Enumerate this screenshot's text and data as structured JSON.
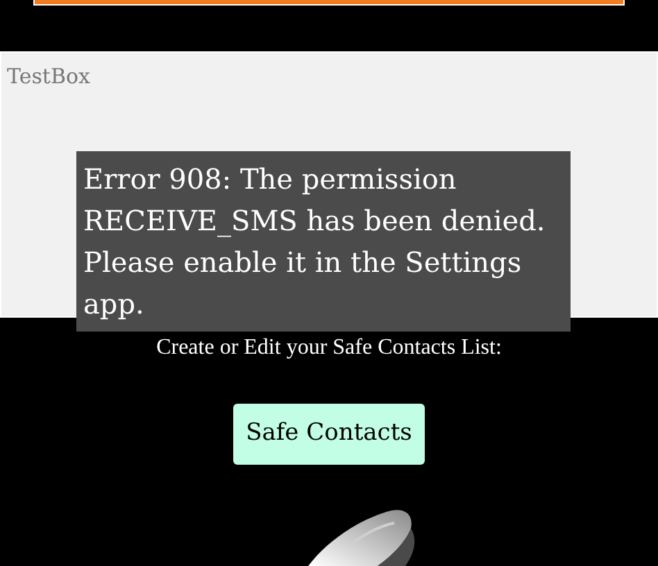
{
  "text_box": {
    "placeholder": "TestBox"
  },
  "toast": {
    "message": "Error 908: The permission RECEIVE_SMS has been denied. Please enable it in the Settings app."
  },
  "prompt": "Create or Edit your Safe Contacts List:",
  "safe_contacts_button": {
    "label": "Safe Contacts"
  }
}
